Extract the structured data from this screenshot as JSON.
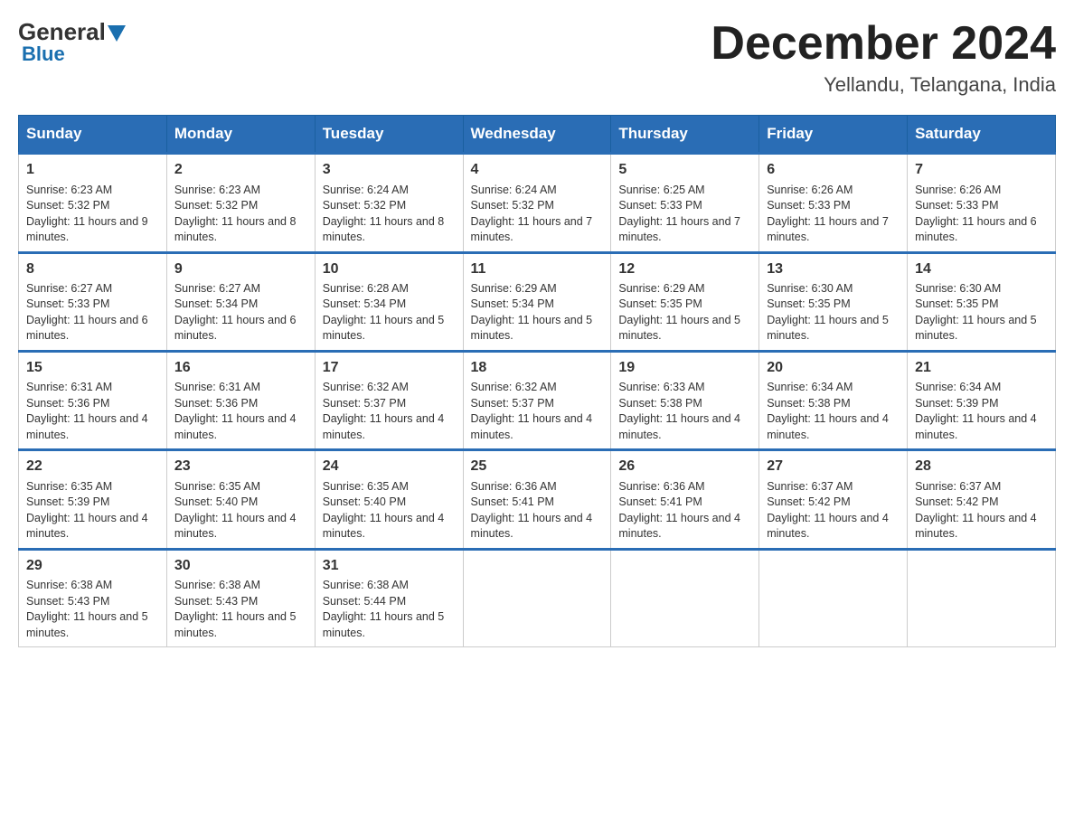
{
  "header": {
    "logo": {
      "general": "General",
      "blue": "Blue",
      "triangle": "▲"
    },
    "title": "December 2024",
    "subtitle": "Yellandu, Telangana, India"
  },
  "weekdays": [
    "Sunday",
    "Monday",
    "Tuesday",
    "Wednesday",
    "Thursday",
    "Friday",
    "Saturday"
  ],
  "weeks": [
    [
      {
        "day": "1",
        "sunrise": "6:23 AM",
        "sunset": "5:32 PM",
        "daylight": "11 hours and 9 minutes."
      },
      {
        "day": "2",
        "sunrise": "6:23 AM",
        "sunset": "5:32 PM",
        "daylight": "11 hours and 8 minutes."
      },
      {
        "day": "3",
        "sunrise": "6:24 AM",
        "sunset": "5:32 PM",
        "daylight": "11 hours and 8 minutes."
      },
      {
        "day": "4",
        "sunrise": "6:24 AM",
        "sunset": "5:32 PM",
        "daylight": "11 hours and 7 minutes."
      },
      {
        "day": "5",
        "sunrise": "6:25 AM",
        "sunset": "5:33 PM",
        "daylight": "11 hours and 7 minutes."
      },
      {
        "day": "6",
        "sunrise": "6:26 AM",
        "sunset": "5:33 PM",
        "daylight": "11 hours and 7 minutes."
      },
      {
        "day": "7",
        "sunrise": "6:26 AM",
        "sunset": "5:33 PM",
        "daylight": "11 hours and 6 minutes."
      }
    ],
    [
      {
        "day": "8",
        "sunrise": "6:27 AM",
        "sunset": "5:33 PM",
        "daylight": "11 hours and 6 minutes."
      },
      {
        "day": "9",
        "sunrise": "6:27 AM",
        "sunset": "5:34 PM",
        "daylight": "11 hours and 6 minutes."
      },
      {
        "day": "10",
        "sunrise": "6:28 AM",
        "sunset": "5:34 PM",
        "daylight": "11 hours and 5 minutes."
      },
      {
        "day": "11",
        "sunrise": "6:29 AM",
        "sunset": "5:34 PM",
        "daylight": "11 hours and 5 minutes."
      },
      {
        "day": "12",
        "sunrise": "6:29 AM",
        "sunset": "5:35 PM",
        "daylight": "11 hours and 5 minutes."
      },
      {
        "day": "13",
        "sunrise": "6:30 AM",
        "sunset": "5:35 PM",
        "daylight": "11 hours and 5 minutes."
      },
      {
        "day": "14",
        "sunrise": "6:30 AM",
        "sunset": "5:35 PM",
        "daylight": "11 hours and 5 minutes."
      }
    ],
    [
      {
        "day": "15",
        "sunrise": "6:31 AM",
        "sunset": "5:36 PM",
        "daylight": "11 hours and 4 minutes."
      },
      {
        "day": "16",
        "sunrise": "6:31 AM",
        "sunset": "5:36 PM",
        "daylight": "11 hours and 4 minutes."
      },
      {
        "day": "17",
        "sunrise": "6:32 AM",
        "sunset": "5:37 PM",
        "daylight": "11 hours and 4 minutes."
      },
      {
        "day": "18",
        "sunrise": "6:32 AM",
        "sunset": "5:37 PM",
        "daylight": "11 hours and 4 minutes."
      },
      {
        "day": "19",
        "sunrise": "6:33 AM",
        "sunset": "5:38 PM",
        "daylight": "11 hours and 4 minutes."
      },
      {
        "day": "20",
        "sunrise": "6:34 AM",
        "sunset": "5:38 PM",
        "daylight": "11 hours and 4 minutes."
      },
      {
        "day": "21",
        "sunrise": "6:34 AM",
        "sunset": "5:39 PM",
        "daylight": "11 hours and 4 minutes."
      }
    ],
    [
      {
        "day": "22",
        "sunrise": "6:35 AM",
        "sunset": "5:39 PM",
        "daylight": "11 hours and 4 minutes."
      },
      {
        "day": "23",
        "sunrise": "6:35 AM",
        "sunset": "5:40 PM",
        "daylight": "11 hours and 4 minutes."
      },
      {
        "day": "24",
        "sunrise": "6:35 AM",
        "sunset": "5:40 PM",
        "daylight": "11 hours and 4 minutes."
      },
      {
        "day": "25",
        "sunrise": "6:36 AM",
        "sunset": "5:41 PM",
        "daylight": "11 hours and 4 minutes."
      },
      {
        "day": "26",
        "sunrise": "6:36 AM",
        "sunset": "5:41 PM",
        "daylight": "11 hours and 4 minutes."
      },
      {
        "day": "27",
        "sunrise": "6:37 AM",
        "sunset": "5:42 PM",
        "daylight": "11 hours and 4 minutes."
      },
      {
        "day": "28",
        "sunrise": "6:37 AM",
        "sunset": "5:42 PM",
        "daylight": "11 hours and 4 minutes."
      }
    ],
    [
      {
        "day": "29",
        "sunrise": "6:38 AM",
        "sunset": "5:43 PM",
        "daylight": "11 hours and 5 minutes."
      },
      {
        "day": "30",
        "sunrise": "6:38 AM",
        "sunset": "5:43 PM",
        "daylight": "11 hours and 5 minutes."
      },
      {
        "day": "31",
        "sunrise": "6:38 AM",
        "sunset": "5:44 PM",
        "daylight": "11 hours and 5 minutes."
      },
      null,
      null,
      null,
      null
    ]
  ]
}
